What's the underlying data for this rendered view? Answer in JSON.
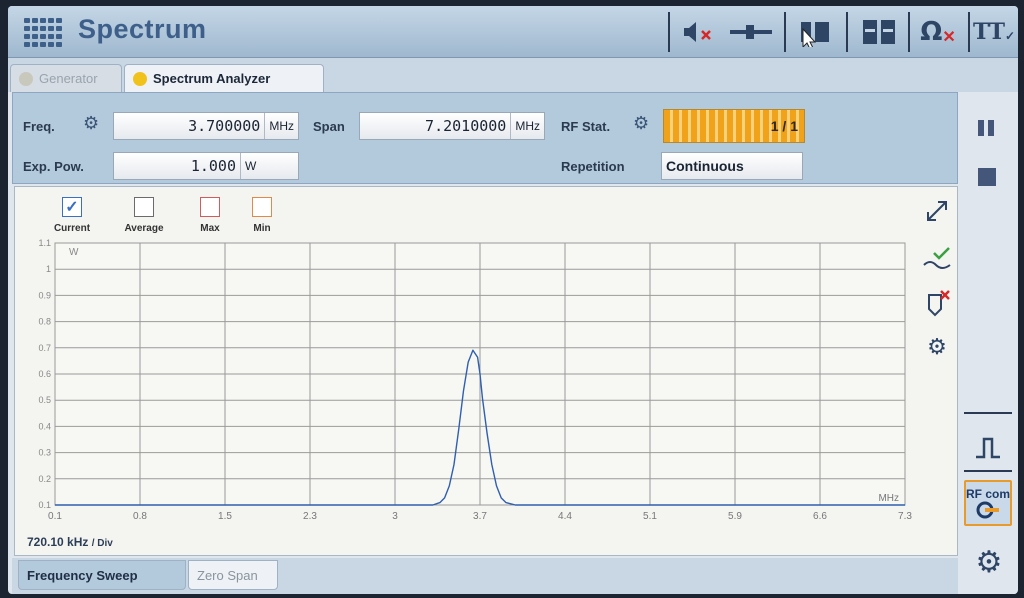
{
  "app": {
    "title": "Spectrum"
  },
  "tabs": [
    {
      "label": "Generator",
      "active": false
    },
    {
      "label": "Spectrum Analyzer",
      "active": true
    }
  ],
  "params": {
    "freq": {
      "label": "Freq.",
      "value": "3.700000",
      "unit": "MHz"
    },
    "exp_pow": {
      "label": "Exp. Pow.",
      "value": "1.000",
      "unit": "W"
    },
    "span": {
      "label": "Span",
      "value": "7.2010000",
      "unit": "MHz"
    },
    "rf_stat": {
      "label": "RF Stat.",
      "progress_text": "1 / 1",
      "progress_fraction": 1.0
    },
    "repetition": {
      "label": "Repetition",
      "value": "Continuous"
    }
  },
  "legend": [
    {
      "label": "Current",
      "checked": true,
      "color": "#3a6fc4"
    },
    {
      "label": "Average",
      "checked": false,
      "color": "#6b6b6b"
    },
    {
      "label": "Max",
      "checked": false,
      "color": "#d25b5b"
    },
    {
      "label": "Min",
      "checked": false,
      "color": "#e0894a"
    }
  ],
  "chart_data": {
    "type": "line",
    "ylabel": "W",
    "xunit": "MHz",
    "ylim": [
      0,
      1.1
    ],
    "xlim": [
      0.1,
      7.3
    ],
    "y_ticks": [
      "1.1",
      "1",
      "0.9",
      "0.8",
      "0.7",
      "0.6",
      "0.5",
      "0.4",
      "0.3",
      "0.2",
      "0.1"
    ],
    "x_ticks": [
      "0.1",
      "0.8",
      "1.5",
      "2.3",
      "3",
      "3.7",
      "4.4",
      "5.1",
      "5.9",
      "6.6",
      "7.3"
    ],
    "grid": true,
    "series": [
      {
        "color": "#2f5fae",
        "x": [
          0.1,
          3.3,
          3.36,
          3.4,
          3.44,
          3.48,
          3.52,
          3.56,
          3.6,
          3.64,
          3.68,
          3.7,
          3.72,
          3.76,
          3.8,
          3.84,
          3.88,
          3.92,
          3.96,
          4.0,
          4.06,
          7.3
        ],
        "y": [
          0.0,
          0.0,
          0.01,
          0.03,
          0.08,
          0.17,
          0.32,
          0.48,
          0.6,
          0.65,
          0.62,
          0.55,
          0.45,
          0.3,
          0.17,
          0.08,
          0.03,
          0.01,
          0.005,
          0.0,
          0.0,
          0.0
        ]
      }
    ]
  },
  "scale": {
    "per_div": "720.10 kHz",
    "per_div_suffix": "/ Div"
  },
  "bottom_tabs": [
    {
      "label": "Frequency Sweep",
      "active": true
    },
    {
      "label": "Zero Span",
      "active": false
    }
  ],
  "icons": {
    "mute": "speaker-muted-icon",
    "volume": "volume-slider-icon",
    "pointer": "mouse-pointer-icon",
    "omega_red_x": "omega-icon",
    "rf_com": "RF com"
  }
}
